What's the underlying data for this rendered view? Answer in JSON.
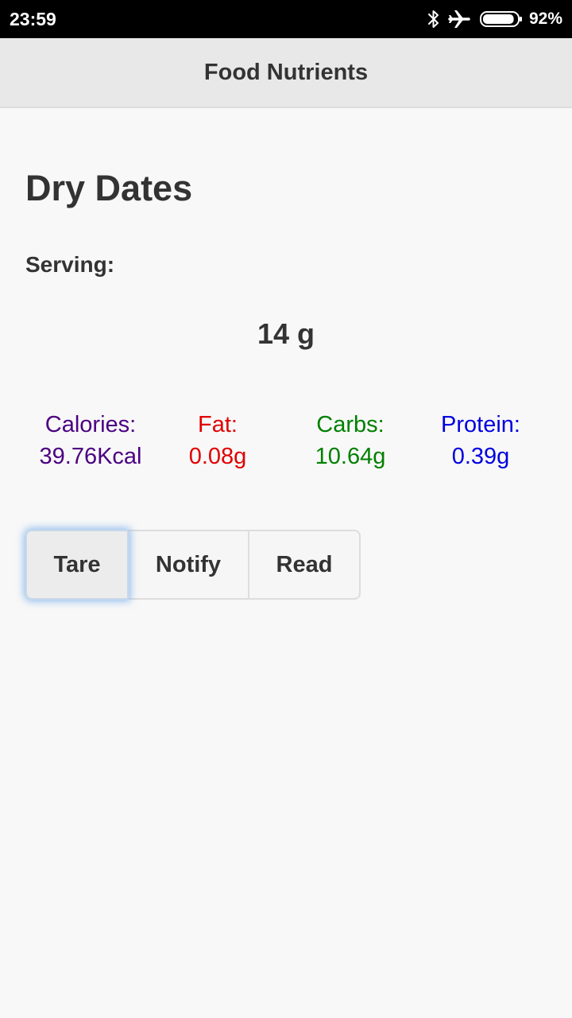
{
  "status_bar": {
    "time": "23:59",
    "icons": [
      "bluetooth-icon",
      "airplane-mode-icon",
      "battery-icon"
    ],
    "battery_percent": "92%",
    "battery_level": 0.92
  },
  "header": {
    "title": "Food Nutrients"
  },
  "food": {
    "name": "Dry Dates",
    "serving_label": "Serving:",
    "serving_value": "14 g"
  },
  "nutrients": {
    "calories": {
      "label": "Calories:",
      "value": "39.76Kcal",
      "color": "#4b0082"
    },
    "fat": {
      "label": "Fat:",
      "value": "0.08g",
      "color": "#e00000"
    },
    "carbs": {
      "label": "Carbs:",
      "value": "10.64g",
      "color": "#008000"
    },
    "protein": {
      "label": "Protein:",
      "value": "0.39g",
      "color": "#0000e0"
    }
  },
  "buttons": {
    "tare": "Tare",
    "notify": "Notify",
    "read": "Read"
  }
}
